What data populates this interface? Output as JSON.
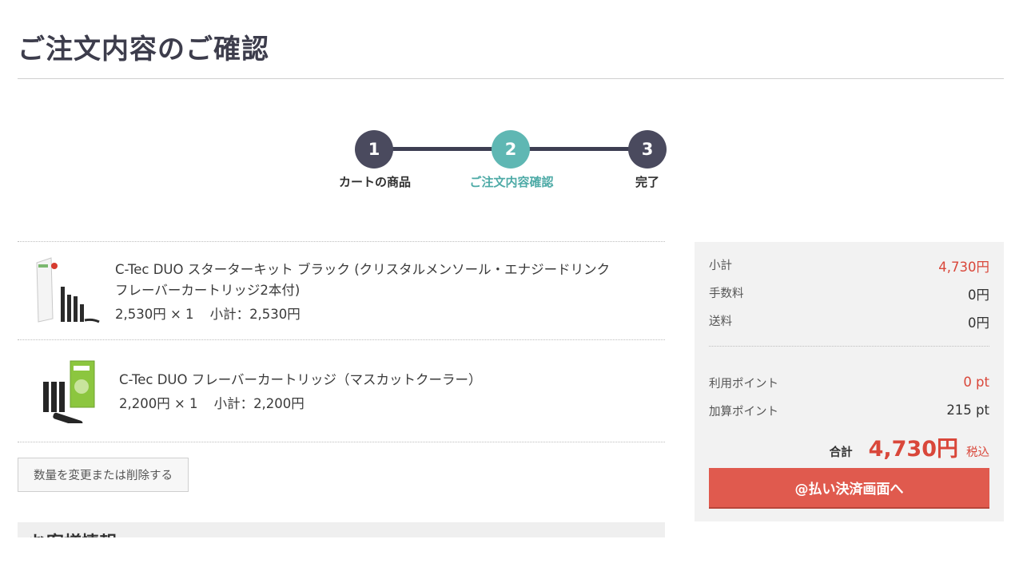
{
  "page": {
    "title": "ご注文内容のご確認"
  },
  "steps": [
    {
      "number": "1",
      "label": "カートの商品"
    },
    {
      "number": "2",
      "label": "ご注文内容確認"
    },
    {
      "number": "3",
      "label": "完了"
    }
  ],
  "items": [
    {
      "name_line1": "C-Tec DUO スターターキット ブラック (クリスタルメンソール・エナジードリンク",
      "name_line2": "フレーバーカートリッジ2本付)",
      "unit_qty": "2,530円 × 1",
      "subtotal": "小計：2,530円"
    },
    {
      "name_line1": "C-Tec DUO フレーバーカートリッジ（マスカットクーラー）",
      "unit_qty": "2,200円 × 1",
      "subtotal": "小計：2,200円"
    }
  ],
  "edit_button": "数量を変更または削除する",
  "customer_section_title": "お客様情報",
  "summary": {
    "subtotal_label": "小計",
    "subtotal_value": "4,730円",
    "fee_label": "手数料",
    "fee_value": "0円",
    "shipping_label": "送料",
    "shipping_value": "0円",
    "points_used_label": "利用ポイント",
    "points_used_value": "0 pt",
    "points_added_label": "加算ポイント",
    "points_added_value": "215 pt",
    "total_label": "合計",
    "total_value": "4,730円",
    "tax_note": "税込",
    "pay_button": "@払い決済画面へ"
  },
  "colors": {
    "accent_red": "#d9473a",
    "step_active": "#5fb7b3",
    "step_dark": "#4a4a5e",
    "button_red": "#e05a4e"
  }
}
